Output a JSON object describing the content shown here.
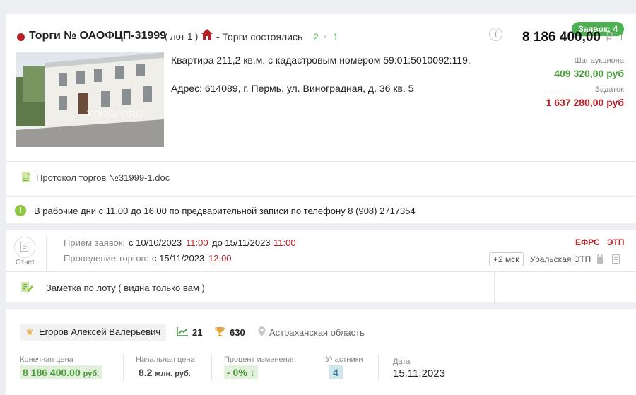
{
  "lot": {
    "bids_badge": "Заявок:  4",
    "title": "Торги № ОАОФЦП-31999",
    "lot_number": "( лот 1 )",
    "status": "- Торги состоялись",
    "step_from": "2",
    "step_sep": "›",
    "step_to": "1",
    "info_icon_label": "i",
    "price": "8 186 400,00",
    "currency_symbol": "₽",
    "trend_arrow": "↑",
    "description": "Квартира 211,2 кв.м. с кадастровым номером 59:01:5010092:119.",
    "address": "Адрес: 614089, г. Пермь, ул. Виноградная, д. 36 кв. 5",
    "step_label": "Шаг аукциона",
    "step_value": "409 320,00 руб",
    "deposit_label": "Задаток",
    "deposit_value": "1 637 280,00 руб",
    "photo_watermark": "TORGI.ORG"
  },
  "protocol": {
    "link_text": "Протокол торгов №31999-1.doc"
  },
  "info": {
    "icon": "i",
    "text": "В рабочие дни с 11.00 до 16.00 по предварительной записи по телефону 8 (908) 2717354"
  },
  "schedule": {
    "report_label": "Отчет",
    "accept_label": "Прием заявок:",
    "accept_from": "с 10/10/2023",
    "accept_from_time": "11:00",
    "accept_to": "до 15/11/2023",
    "accept_to_time": "11:00",
    "auction_label": "Проведение торгов:",
    "auction_from": "с 15/11/2023",
    "auction_time": "12:00",
    "tag_efrs": "ЕФРС",
    "tag_etp": "ЭТП",
    "timezone": "+2 мск",
    "platform": "Уральская ЭТП",
    "note_text": "Заметка по лоту ( видна только вам )"
  },
  "result": {
    "winner": "Егоров Алексей Валерьевич",
    "stat_trend": "21",
    "stat_wins": "630",
    "region": "Астраханская область",
    "final_price_label": "Конечная цена",
    "final_price_value": "8 186 400.00",
    "final_price_unit": "руб.",
    "start_price_label": "Начальная цена",
    "start_price_value": "8.2",
    "start_price_unit": "млн. руб.",
    "change_label": "Процент изменения",
    "change_value": "- 0%",
    "change_arrow": "↓",
    "participants_label": "Участники",
    "participants_value": "4",
    "date_label": "Дата",
    "date_value": "15.11.2023"
  },
  "colors": {
    "accent_green": "#4caf50",
    "accent_red": "#b72025",
    "text_green": "#4a9c3a"
  }
}
